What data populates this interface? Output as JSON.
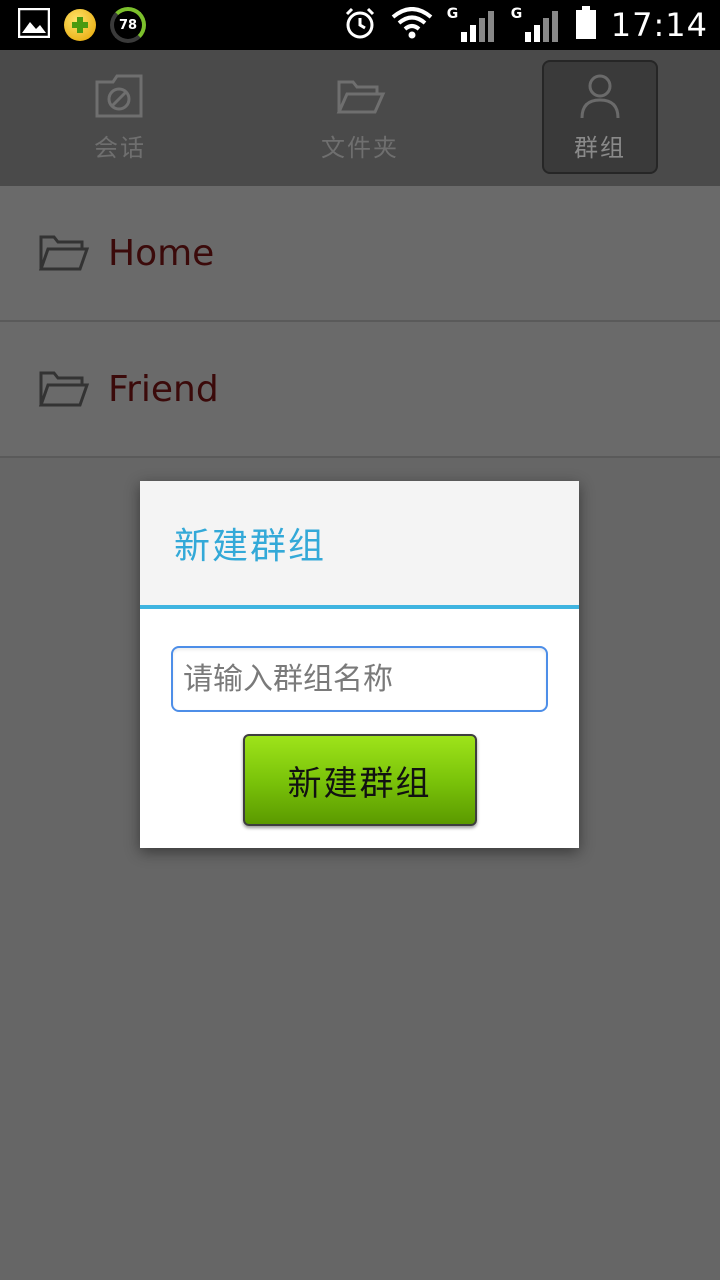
{
  "status_bar": {
    "battery_percent": "78",
    "time": "17:14",
    "network_1": "G",
    "network_2": "G"
  },
  "tabs": [
    {
      "label": "会话",
      "icon": "chat-icon"
    },
    {
      "label": "文件夹",
      "icon": "folder-icon"
    },
    {
      "label": "群组",
      "icon": "person-icon",
      "active": true
    }
  ],
  "groups": [
    {
      "name": "Home"
    },
    {
      "name": "Friend"
    }
  ],
  "dialog": {
    "title": "新建群组",
    "input_placeholder": "请输入群组名称",
    "input_value": "",
    "submit_label": "新建群组"
  },
  "colors": {
    "accent": "#33a9d8",
    "button_green": "#7bc40a",
    "list_text": "#3b0a0a"
  }
}
